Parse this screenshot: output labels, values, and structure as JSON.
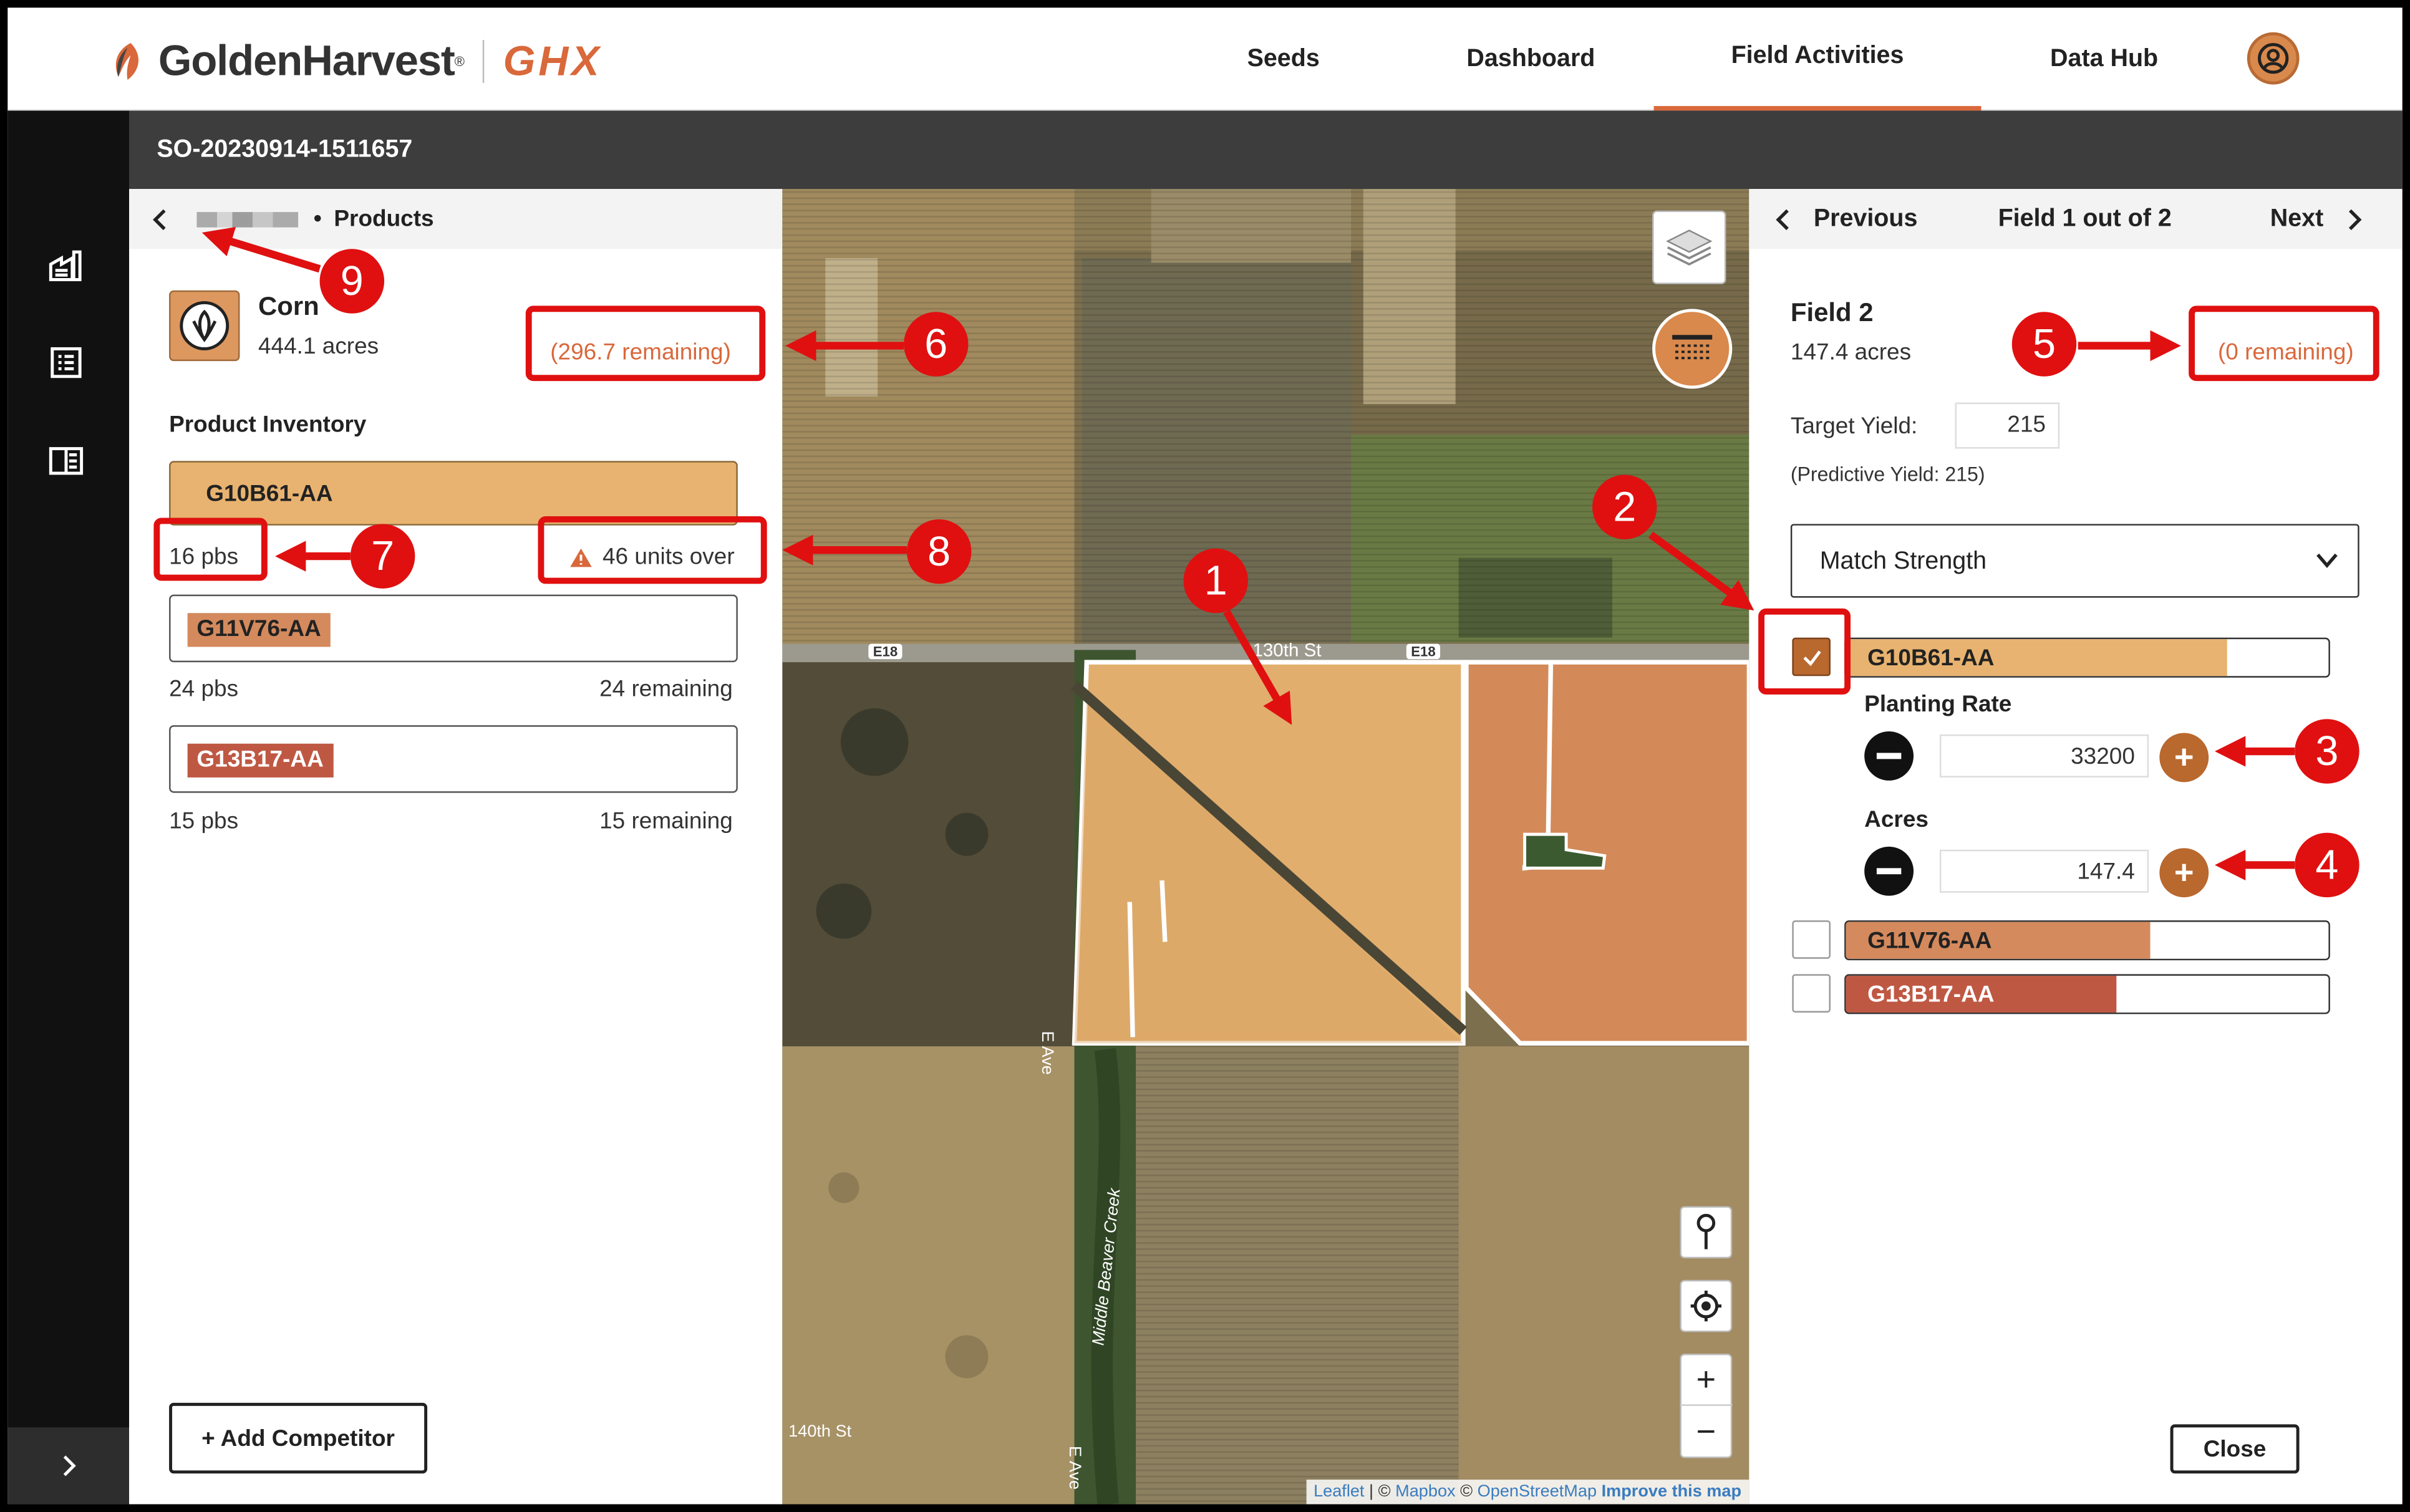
{
  "header": {
    "brand": "GoldenHarvest",
    "brand_mark": "®",
    "brand_sub": "GHX",
    "nav": [
      "Seeds",
      "Dashboard",
      "Field Activities",
      "Data Hub"
    ],
    "active_nav": "Field Activities",
    "accent": "#d9683b"
  },
  "order_id": "SO-20230914-1511657",
  "left": {
    "breadcrumb": "Products",
    "breadcrumb_sep": "•",
    "crop": "Corn",
    "crop_acres": "444.1 acres",
    "crop_remaining": "(296.7 remaining)",
    "inventory_heading": "Product Inventory",
    "products": [
      {
        "name": "G10B61-AA",
        "qty": "16 pbs",
        "status": "46 units over"
      },
      {
        "name": "G11V76-AA",
        "qty": "24 pbs",
        "status": "24 remaining"
      },
      {
        "name": "G13B17-AA",
        "qty": "15 pbs",
        "status": "15 remaining"
      }
    ],
    "add_competitor": "+ Add Competitor"
  },
  "map": {
    "labels": [
      "130th St",
      "E18",
      "E18",
      "E Ave",
      "Middle Beaver Creek",
      "140th St",
      "E Ave"
    ],
    "attribution": {
      "leaflet": "Leaflet",
      "sep": "|",
      "copy1": "©",
      "mapbox": "Mapbox",
      "copy2": "©",
      "osm": "OpenStreetMap",
      "improve": "Improve this map"
    }
  },
  "right": {
    "prev": "Previous",
    "counter": "Field 1 out of 2",
    "next": "Next",
    "field_name": "Field 2",
    "field_acres": "147.4 acres",
    "field_remaining": "(0 remaining)",
    "target_yield_label": "Target Yield:",
    "target_yield": "215",
    "predictive": "(Predictive Yield: 215)",
    "sort": "Match Strength",
    "products": [
      {
        "name": "G10B61-AA",
        "checked": true,
        "strength": 0.79,
        "color": "#e8b370"
      },
      {
        "name": "G11V76-AA",
        "checked": false,
        "strength": 0.63,
        "color": "#d48a5d"
      },
      {
        "name": "G13B17-AA",
        "checked": false,
        "strength": 0.56,
        "color": "#bf5843"
      }
    ],
    "planting_rate_label": "Planting Rate",
    "planting_rate": "33200",
    "acres_label": "Acres",
    "acres": "147.4",
    "close": "Close"
  },
  "callouts": [
    "1",
    "2",
    "3",
    "4",
    "5",
    "6",
    "7",
    "8",
    "9"
  ]
}
